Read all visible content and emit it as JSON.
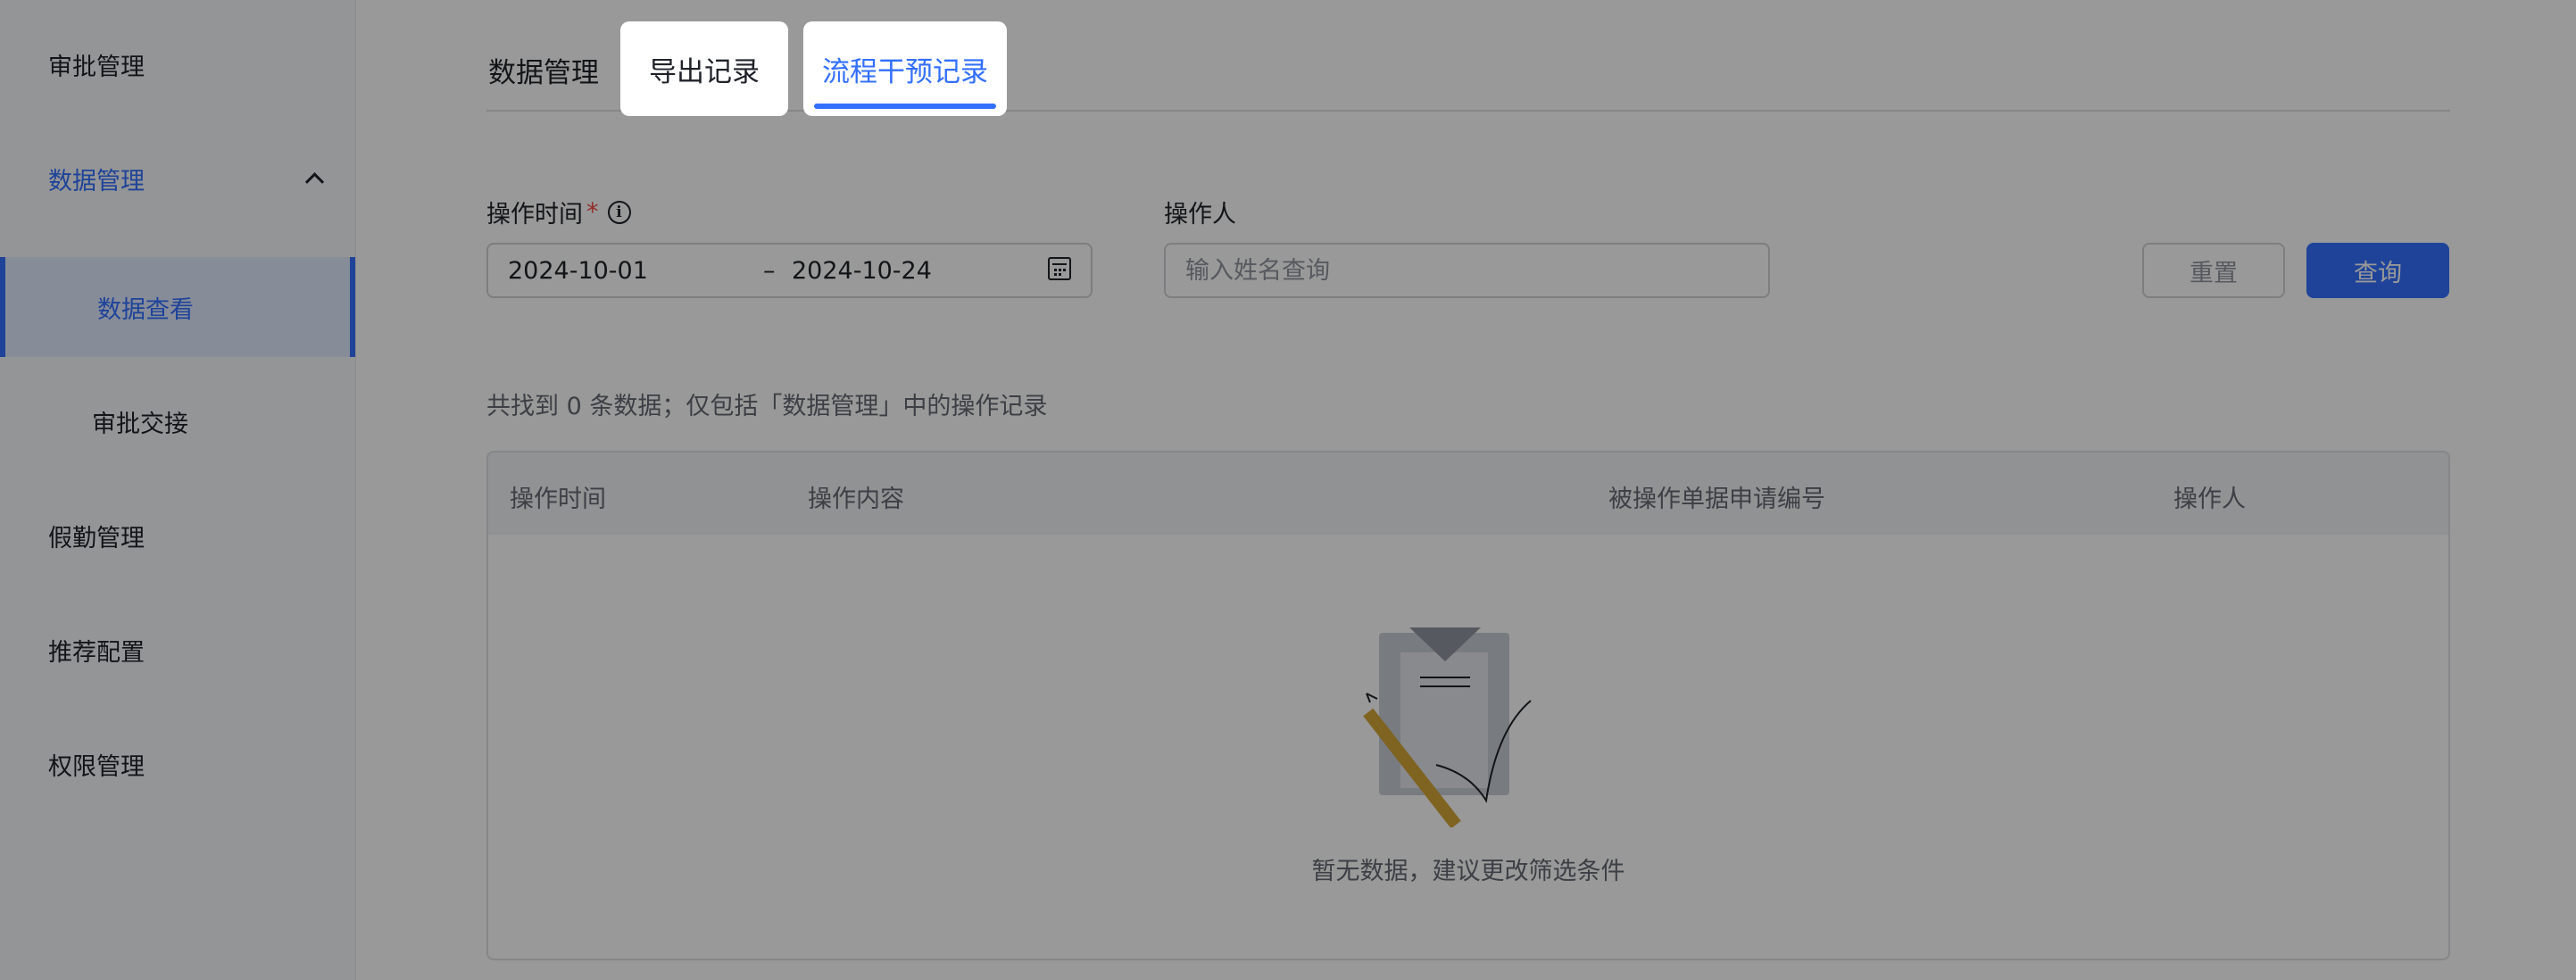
{
  "sidebar": {
    "items": [
      {
        "label": "审批管理"
      },
      {
        "label": "数据管理"
      },
      {
        "label": "数据查看"
      },
      {
        "label": "审批交接"
      },
      {
        "label": "假勤管理"
      },
      {
        "label": "推荐配置"
      },
      {
        "label": "权限管理"
      }
    ]
  },
  "tabs": {
    "items": [
      {
        "label": "数据管理"
      },
      {
        "label": "导出记录"
      },
      {
        "label": "流程干预记录",
        "selected": true
      }
    ]
  },
  "filters": {
    "op_time_label": "操作时间",
    "required_mark": "*",
    "start_date": "2024-10-01",
    "range_separator": "–",
    "end_date": "2024-10-24",
    "operator_label": "操作人",
    "operator_placeholder": "输入姓名查询",
    "reset_label": "重置",
    "query_label": "查询"
  },
  "summary": "共找到 0 条数据；仅包括「数据管理」中的操作记录",
  "table": {
    "columns": [
      "操作时间",
      "操作内容",
      "被操作单据申请编号",
      "操作人"
    ],
    "rows": [],
    "empty_text": "暂无数据，建议更改筛选条件"
  },
  "colors": {
    "accent": "#3370ff",
    "required": "#f54a45"
  }
}
